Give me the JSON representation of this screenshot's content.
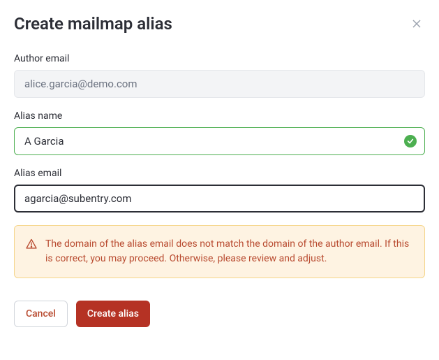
{
  "modal": {
    "title": "Create mailmap alias",
    "close_label": "Close"
  },
  "form": {
    "author_email": {
      "label": "Author email",
      "value": "alice.garcia@demo.com"
    },
    "alias_name": {
      "label": "Alias name",
      "value": "A Garcia"
    },
    "alias_email": {
      "label": "Alias email",
      "value": "agarcia@subentry.com"
    }
  },
  "warning": {
    "message": "The domain of the alias email does not match the domain of the author email. If this is correct, you may proceed. Otherwise, please review and adjust."
  },
  "actions": {
    "cancel_label": "Cancel",
    "submit_label": "Create alias"
  }
}
